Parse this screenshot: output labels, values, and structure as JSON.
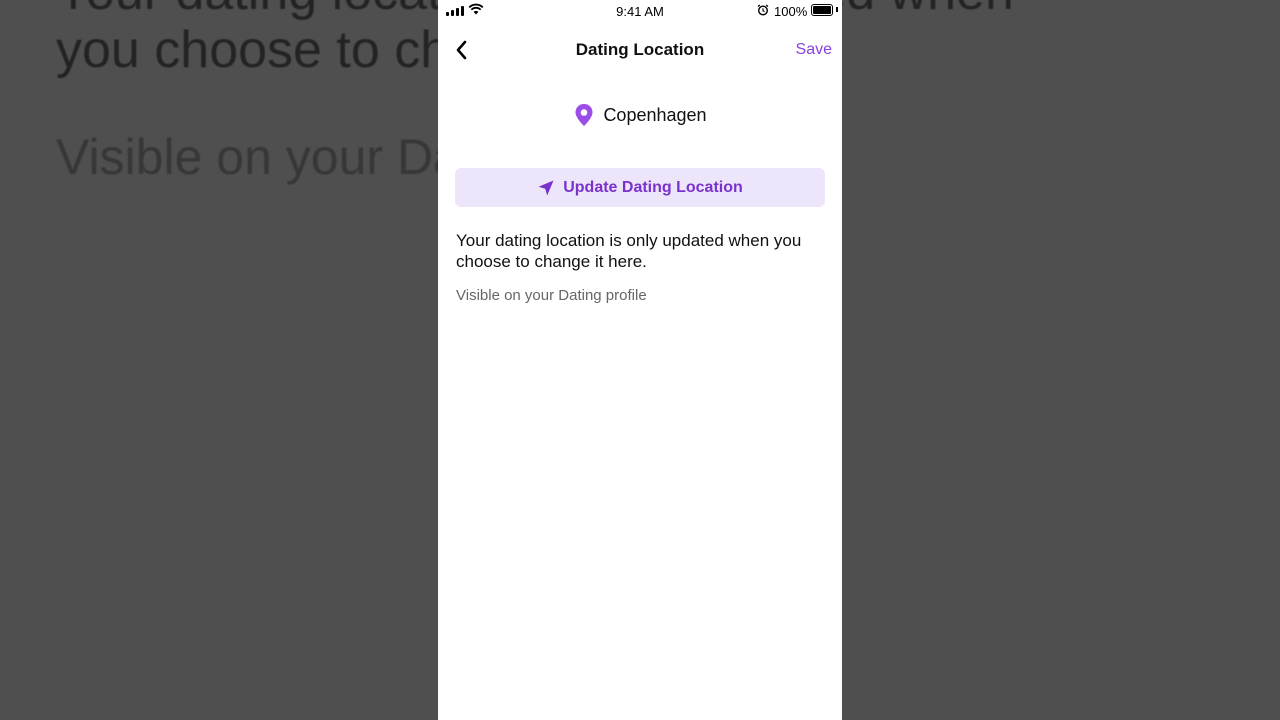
{
  "status_bar": {
    "time": "9:41 AM",
    "battery_percent": "100%",
    "icons": [
      "cellular-signal-icon",
      "wifi-icon",
      "alarm-icon",
      "battery-icon"
    ]
  },
  "nav": {
    "title": "Dating Location",
    "save_label": "Save",
    "back_icon": "chevron-left-icon"
  },
  "location": {
    "name": "Copenhagen",
    "icon": "location-pin-icon"
  },
  "update_button": {
    "label": "Update Dating Location",
    "icon": "navigation-arrow-icon"
  },
  "info": {
    "description": "Your dating location is only updated when you choose to change it here.",
    "visibility_note": "Visible on your Dating profile"
  },
  "background": {
    "line1": "Your dating location is only updated when",
    "line2": "you choose to change it here.",
    "line3": "Visible on your Dating profile"
  },
  "colors": {
    "accent": "#8a3fe0",
    "button_bg": "#ede6fb",
    "button_text": "#7a32cc",
    "pin": "#9b4de8"
  }
}
